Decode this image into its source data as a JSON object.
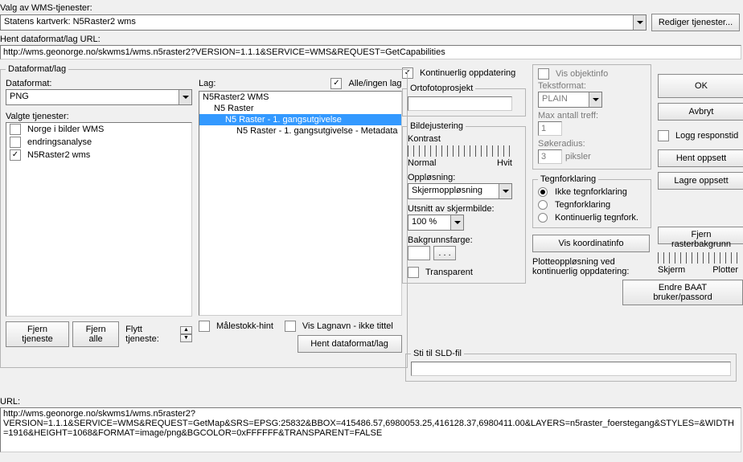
{
  "top": {
    "valg_label": "Valg av WMS-tjenester:",
    "service_value": "Statens kartverk: N5Raster2 wms",
    "rediger_btn": "Rediger tjenester...",
    "url_label": "Hent dataformat/lag URL:",
    "url_value": "http://wms.geonorge.no/skwms1/wms.n5raster2?VERSION=1.1.1&SERVICE=WMS&REQUEST=GetCapabilities"
  },
  "dataformat": {
    "legend": "Dataformat/lag",
    "dataformat_label": "Dataformat:",
    "dataformat_value": "PNG",
    "valgte_label": "Valgte tjenester:",
    "services": [
      {
        "label": "Norge i bilder WMS",
        "checked": false
      },
      {
        "label": "endringsanalyse",
        "checked": false
      },
      {
        "label": "N5Raster2 wms",
        "checked": true
      }
    ],
    "lag_label": "Lag:",
    "alle_ingen": "Alle/ingen lag",
    "layers": [
      {
        "text": "N5Raster2 WMS",
        "indent": 0,
        "sel": false
      },
      {
        "text": "N5 Raster",
        "indent": 1,
        "sel": false
      },
      {
        "text": "N5 Raster - 1. gangsutgivelse",
        "indent": 2,
        "sel": true
      },
      {
        "text": "N5 Raster - 1. gangsutgivelse - Metadata",
        "indent": 3,
        "sel": false
      }
    ],
    "fjern_tjeneste": "Fjern tjeneste",
    "fjern_alle": "Fjern alle",
    "flytt_label": "Flytt tjeneste:",
    "malestokk_hint": "Målestokk-hint",
    "vis_lagnavn": "Vis Lagnavn - ikke tittel",
    "hent_btn": "Hent dataformat/lag"
  },
  "mid": {
    "kont_opp": "Kontinuerlig oppdatering",
    "orto_legend": "Ortofotoprosjekt",
    "bilde_legend": "Bildejustering",
    "kontrast": "Kontrast",
    "normal": "Normal",
    "hvit": "Hvit",
    "opplosning": "Oppløsning:",
    "opp_value": "Skjermoppløsning",
    "utsnitt": "Utsnitt av skjermbilde:",
    "utsnitt_value": "100 %",
    "bakgrunn": "Bakgrunnsfarge:",
    "dots": ". . .",
    "transparent": "Transparent"
  },
  "obj": {
    "vis_objektinfo": "Vis objektinfo",
    "tekstformat": "Tekstformat:",
    "tekstformat_value": "PLAIN",
    "max_treff": "Max antall treff:",
    "max_treff_value": "1",
    "sokeradius": "Søkeradius:",
    "sokeradius_value": "3",
    "piksler": "piksler",
    "tegn_legend": "Tegnforklaring",
    "r1": "Ikke tegnforklaring",
    "r2": "Tegnforklaring",
    "r3": "Kontinuerlig tegnfork.",
    "vis_koord": "Vis koordinatinfo",
    "plotte": "Plotteoppløsning ved kontinuerlig oppdatering:",
    "skjerm": "Skjerm",
    "plotter": "Plotter"
  },
  "side": {
    "ok": "OK",
    "avbryt": "Avbryt",
    "logg": "Logg responstid",
    "hent": "Hent oppsett",
    "lagre": "Lagre oppsett",
    "fjern_raster": "Fjern rasterbakgrunn",
    "endre_baat": "Endre BAAT bruker/passord"
  },
  "sld": {
    "legend": "Sti til SLD-fil"
  },
  "bottom": {
    "url_label": "URL:",
    "url_value": "http://wms.geonorge.no/skwms1/wms.n5raster2?\nVERSION=1.1.1&SERVICE=WMS&REQUEST=GetMap&SRS=EPSG:25832&BBOX=415486.57,6980053.25,416128.37,6980411.00&LAYERS=n5raster_foerstegang&STYLES=&WIDTH=1916&HEIGHT=1068&FORMAT=image/png&BGCOLOR=0xFFFFFF&TRANSPARENT=FALSE"
  }
}
